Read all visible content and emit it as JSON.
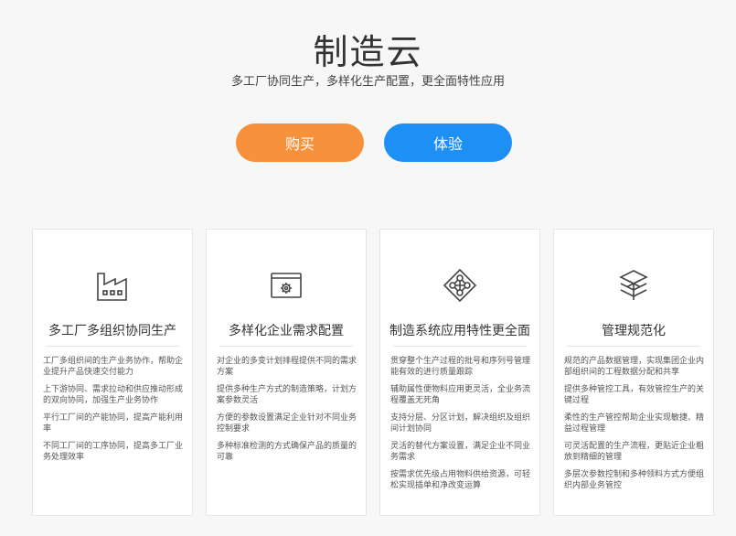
{
  "header": {
    "title": "制造云",
    "subtitle": "多工厂协同生产，多样化生产配置，更全面特性应用"
  },
  "actions": {
    "buy_label": "购买",
    "try_label": "体验"
  },
  "colors": {
    "buy": "#f7913c",
    "try": "#1e90f5"
  },
  "cards": [
    {
      "icon": "factory-icon",
      "title": "多工厂多组织协同生产",
      "items": [
        "工厂多组织间的生产业务协作，帮助企业提升产品快速交付能力",
        "上下游协同、需求拉动和供应推动形成的双向协同，加强生产业务协作",
        "平行工厂间的产能协同，提高产能利用率",
        "不同工厂间的工序协同，提高多工厂业务处理效率"
      ]
    },
    {
      "icon": "settings-window-icon",
      "title": "多样化企业需求配置",
      "items": [
        "对企业的多变计划排程提供不同的需求方案",
        "提供多种生产方式的制造策略，计划方案参数灵活",
        "方便的参数设置满足企业针对不同业务控制要求",
        "多种标准检测的方式确保产品的质量的可靠"
      ]
    },
    {
      "icon": "network-diamond-icon",
      "title": "制造系统应用特性更全面",
      "items": [
        "贯穿整个生产过程的批号和序列号管理能有效的进行质量跟踪",
        "辅助属性便物料应用更灵活，全业务流程覆盖无死角",
        "支持分层、分区计划，解决组织及组织间计划协同",
        "灵活的替代方案设置，满足企业不同业务需求",
        "按需求优先级占用物料供给资源，可轻松实现插单和净改变运算"
      ]
    },
    {
      "icon": "layers-icon",
      "title": "管理规范化",
      "items": [
        "规范的产品数据管理，实现集团企业内部组织间的工程数据分配和共享",
        "提供多种管控工具，有效管控生产的关键过程",
        "柔性的生产管控帮助企业实现敏捷、精益过程管理",
        "可灵活配置的生产流程，更贴近企业粗放到精细的管理",
        "多层次参数控制和多种领料方式方便组织内部业务管控"
      ]
    }
  ]
}
